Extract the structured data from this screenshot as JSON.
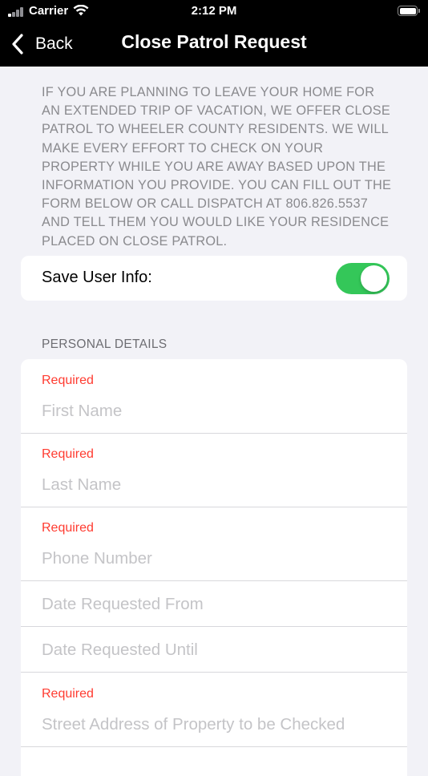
{
  "status_bar": {
    "carrier": "Carrier",
    "time": "2:12 PM"
  },
  "nav": {
    "back_label": "Back",
    "title": "Close Patrol Request"
  },
  "intro_text": "IF YOU ARE PLANNING TO LEAVE YOUR HOME FOR AN EXTENDED TRIP OF VACATION, WE OFFER CLOSE PATROL TO WHEELER COUNTY RESIDENTS. WE WILL MAKE EVERY EFFORT TO CHECK ON YOUR PROPERTY WHILE YOU ARE AWAY BASED UPON THE INFORMATION YOU PROVIDE. YOU CAN FILL OUT THE FORM BELOW OR CALL DISPATCH AT 806.826.5537 AND TELL THEM YOU WOULD LIKE YOUR RESIDENCE PLACED ON CLOSE PATROL.",
  "save_user_info": {
    "label": "Save User Info:",
    "enabled": true
  },
  "personal_details": {
    "header": "PERSONAL DETAILS",
    "required_label": "Required",
    "fields": [
      {
        "placeholder": "First Name",
        "value": "",
        "required": true
      },
      {
        "placeholder": "Last Name",
        "value": "",
        "required": true
      },
      {
        "placeholder": "Phone Number",
        "value": "",
        "required": true
      },
      {
        "placeholder": "Date Requested From",
        "value": "",
        "required": false
      },
      {
        "placeholder": "Date Requested Until",
        "value": "",
        "required": false
      },
      {
        "placeholder": "Street Address of Property to be Checked",
        "value": "",
        "required": true
      }
    ]
  },
  "colors": {
    "nav_background": "#000000",
    "page_background": "#f2f2f7",
    "toggle_on": "#34c759",
    "required": "#ff3b30",
    "placeholder": "#c4c4c7",
    "intro_text": "#8a8a8e"
  }
}
